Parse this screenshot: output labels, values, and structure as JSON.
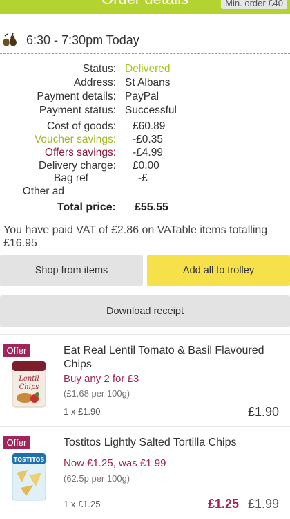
{
  "header": {
    "title": "Order details",
    "min_order": "Min. order £40"
  },
  "delivery": {
    "slot": "6:30 - 7:30pm Today",
    "icon": "pear-icon"
  },
  "details": {
    "status_label": "Status:",
    "status_value": "Delivered",
    "address_label": "Address:",
    "address_value": "St Albans",
    "payment_details_label": "Payment details:",
    "payment_details_value": "PayPal",
    "payment_status_label": "Payment status:",
    "payment_status_value": "Successful"
  },
  "costs": {
    "cost_of_goods_label": "Cost of goods:",
    "cost_of_goods_value": "£60.89",
    "voucher_label": "Voucher savings:",
    "voucher_value": "-£0.35",
    "offers_label": "Offers savings:",
    "offers_value": "-£4.99",
    "delivery_label": "Delivery charge:",
    "delivery_value": "£0.00",
    "bag_label": "Bag ref",
    "bag_value": "-£",
    "other_label": "Other ad",
    "total_label": "Total price:",
    "total_value": "£55.55"
  },
  "vat_note": "You have paid VAT of £2.86 on VATable items totalling £16.95",
  "buttons": {
    "shop_from_items": "Shop from items",
    "add_all_to_trolley": "Add all to trolley",
    "download_receipt": "Download receipt"
  },
  "items": [
    {
      "badge": "Offer",
      "name": "Eat Real Lentil Tomato & Basil Flavoured Chips",
      "promo": "Buy any 2 for £3",
      "unit_price": "(£1.68 per 100g)",
      "qty": "1 x £1.90",
      "price": "£1.90"
    },
    {
      "badge": "Offer",
      "name": "Tostitos Lightly Salted Tortilla Chips",
      "promo": "Now £1.25, was £1.99",
      "unit_price": "(62.5p per 100g)",
      "qty": "1 x £1.25",
      "sale_price": "£1.25",
      "was_price": "£1.99"
    }
  ],
  "colors": {
    "brand_green": "#b3d430",
    "status_green": "#a6c624",
    "offer_maroon": "#a1245a",
    "trolley_yellow": "#f6e14a"
  }
}
